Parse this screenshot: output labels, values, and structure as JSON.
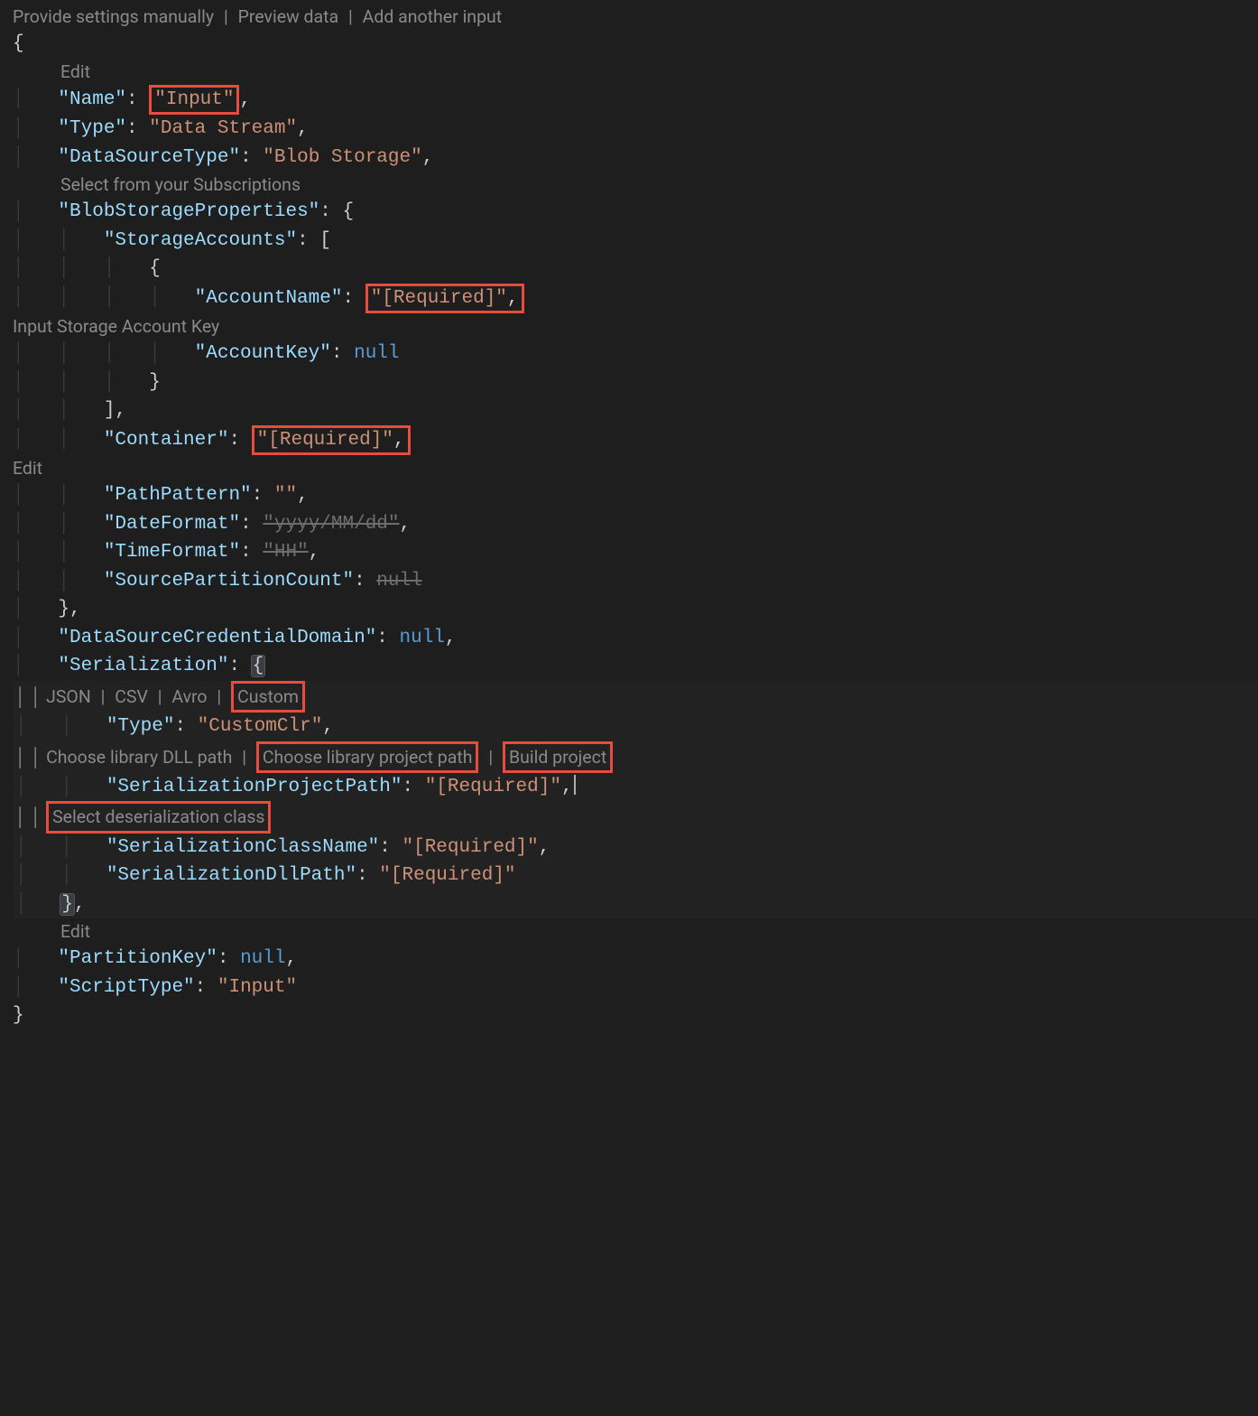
{
  "topHints": {
    "manual": "Provide settings manually",
    "preview": "Preview data",
    "addInput": "Add another input"
  },
  "labels": {
    "edit": "Edit",
    "selectSubs": "Select from your Subscriptions",
    "inputAcctKey": "Input Storage Account Key",
    "ser_json": "JSON",
    "ser_csv": "CSV",
    "ser_avro": "Avro",
    "ser_custom": "Custom",
    "chooseDll": "Choose library DLL path",
    "chooseProj": "Choose library project path",
    "buildProj": "Build project",
    "selectDeser": "Select deserialization class"
  },
  "json": {
    "Name": "\"Input\"",
    "Type": "\"Data Stream\"",
    "DataSourceType": "\"Blob Storage\"",
    "BlobStorageProperties": {
      "StorageAccounts": {
        "AccountName": "\"[Required]\"",
        "AccountKey": "null"
      },
      "Container": "\"[Required]\"",
      "PathPattern": "\"\"",
      "DateFormat": "\"yyyy/MM/dd\"",
      "TimeFormat": "\"HH\"",
      "SourcePartitionCount": "null"
    },
    "DataSourceCredentialDomain": "null",
    "Serialization": {
      "Type": "\"CustomClr\"",
      "SerializationProjectPath": "\"[Required]\"",
      "SerializationClassName": "\"[Required]\"",
      "SerializationDllPath": "\"[Required]\""
    },
    "PartitionKey": "null",
    "ScriptType": "\"Input\""
  },
  "keys": {
    "Name": "\"Name\"",
    "Type": "\"Type\"",
    "DataSourceType": "\"DataSourceType\"",
    "BlobStorageProperties": "\"BlobStorageProperties\"",
    "StorageAccounts": "\"StorageAccounts\"",
    "AccountName": "\"AccountName\"",
    "AccountKey": "\"AccountKey\"",
    "Container": "\"Container\"",
    "PathPattern": "\"PathPattern\"",
    "DateFormat": "\"DateFormat\"",
    "TimeFormat": "\"TimeFormat\"",
    "SourcePartitionCount": "\"SourcePartitionCount\"",
    "DataSourceCredentialDomain": "\"DataSourceCredentialDomain\"",
    "Serialization": "\"Serialization\"",
    "SerType": "\"Type\"",
    "SerializationProjectPath": "\"SerializationProjectPath\"",
    "SerializationClassName": "\"SerializationClassName\"",
    "SerializationDllPath": "\"SerializationDllPath\"",
    "PartitionKey": "\"PartitionKey\"",
    "ScriptType": "\"ScriptType\""
  }
}
